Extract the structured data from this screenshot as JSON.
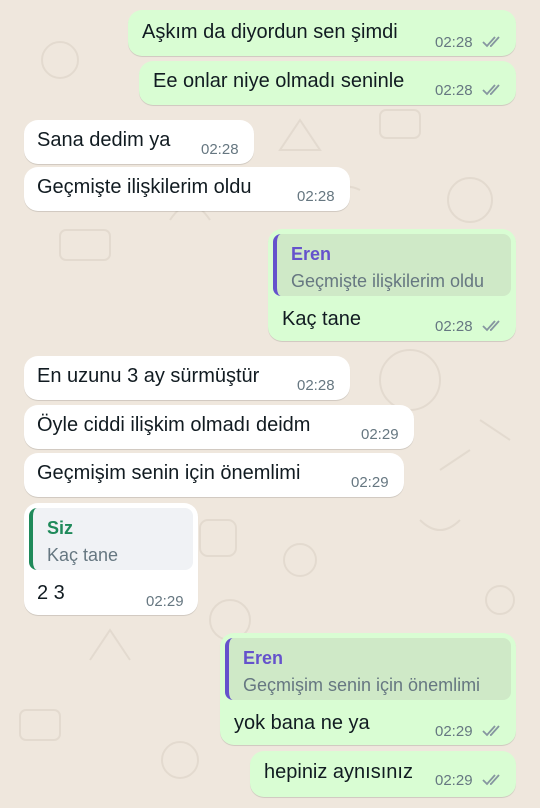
{
  "colors": {
    "wallpaper": "#efe7dd",
    "incoming_bubble": "#ffffff",
    "outgoing_bubble": "#d9fdd3",
    "quote_name_purple": "#6552cc",
    "quote_name_green": "#1f8a5a",
    "read_ticks": "#8696a0"
  },
  "messages": [
    {
      "direction": "out",
      "text": "Aşkım da diyordun sen şimdi",
      "time": "02:28",
      "ticks": "double-check-icon"
    },
    {
      "direction": "out",
      "text": "Ee onlar niye olmadı seninle",
      "time": "02:28",
      "ticks": "double-check-icon"
    },
    {
      "direction": "in",
      "text": "Sana dedim ya",
      "time": "02:28"
    },
    {
      "direction": "in",
      "text": "Geçmişte ilişkilerim oldu",
      "time": "02:28"
    },
    {
      "direction": "out",
      "quote": {
        "name": "Eren",
        "text": "Geçmişte ilişkilerim oldu"
      },
      "text": "Kaç tane",
      "time": "02:28",
      "ticks": "double-check-icon"
    },
    {
      "direction": "in",
      "text": "En uzunu 3 ay sürmüştür",
      "time": "02:28"
    },
    {
      "direction": "in",
      "text": "Öyle ciddi ilişkim olmadı deidm",
      "time": "02:29"
    },
    {
      "direction": "in",
      "text": "Geçmişim senin için önemlimi",
      "time": "02:29"
    },
    {
      "direction": "in",
      "quote": {
        "name": "Siz",
        "text": "Kaç tane"
      },
      "text": "2 3",
      "time": "02:29"
    },
    {
      "direction": "out",
      "quote": {
        "name": "Eren",
        "text": "Geçmişim senin için önemlimi"
      },
      "text": "yok bana ne ya",
      "time": "02:29",
      "ticks": "double-check-icon"
    },
    {
      "direction": "out",
      "text": "hepiniz aynısınız",
      "time": "02:29",
      "ticks": "double-check-icon"
    }
  ]
}
